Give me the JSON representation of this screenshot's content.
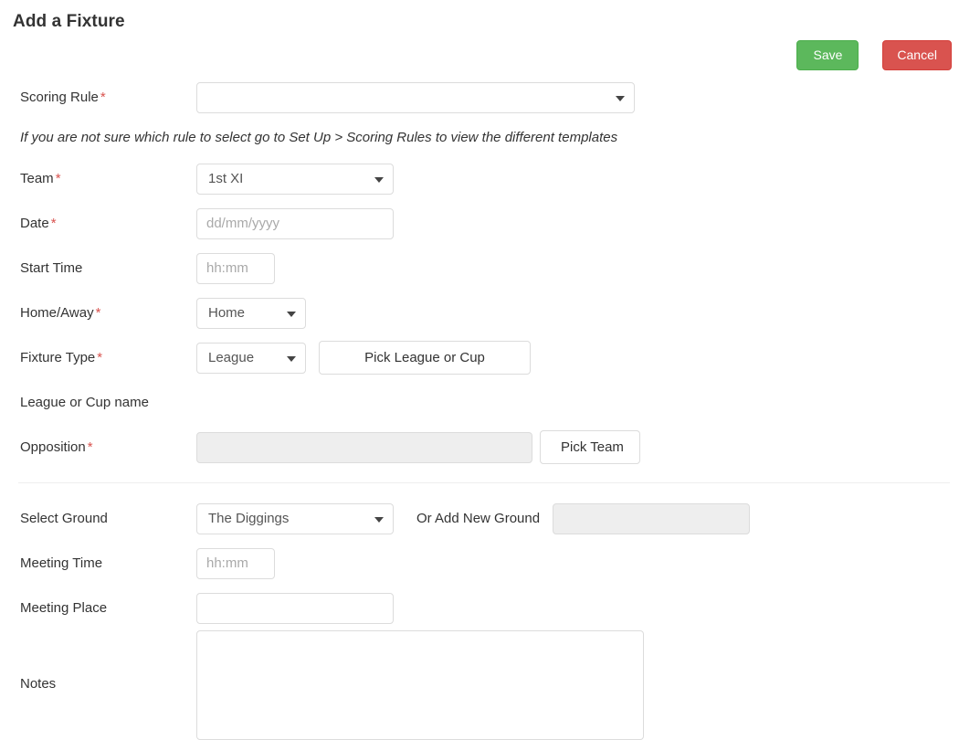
{
  "page": {
    "title": "Add a Fixture"
  },
  "actions": {
    "save_label": "Save",
    "cancel_label": "Cancel",
    "save_color": "#5cb85c",
    "cancel_color": "#d9534f"
  },
  "required_marker": "*",
  "helper_text": "If you are not sure which rule to select go to Set Up > Scoring Rules to view the different templates",
  "fields": {
    "scoring_rule": {
      "label": "Scoring Rule",
      "value": "",
      "required": true
    },
    "team": {
      "label": "Team",
      "value": "1st XI",
      "required": true
    },
    "date": {
      "label": "Date",
      "value": "",
      "placeholder": "dd/mm/yyyy",
      "required": true
    },
    "start_time": {
      "label": "Start Time",
      "value": "",
      "placeholder": "hh:mm",
      "required": false
    },
    "home_away": {
      "label": "Home/Away",
      "value": "Home",
      "required": true
    },
    "fixture_type": {
      "label": "Fixture Type",
      "value": "League",
      "required": true,
      "pick_button_label": "Pick League or Cup"
    },
    "league_or_cup_name": {
      "label": "League or Cup name",
      "value": ""
    },
    "opposition": {
      "label": "Opposition",
      "value": "",
      "required": true,
      "pick_button_label": "Pick Team"
    },
    "select_ground": {
      "label": "Select Ground",
      "value": "The Diggings",
      "required": false
    },
    "add_new_ground": {
      "label": "Or Add New Ground",
      "value": ""
    },
    "meeting_time": {
      "label": "Meeting Time",
      "value": "",
      "placeholder": "hh:mm",
      "required": false
    },
    "meeting_place": {
      "label": "Meeting Place",
      "value": "",
      "required": false
    },
    "notes": {
      "label": "Notes",
      "value": "",
      "required": false
    }
  }
}
